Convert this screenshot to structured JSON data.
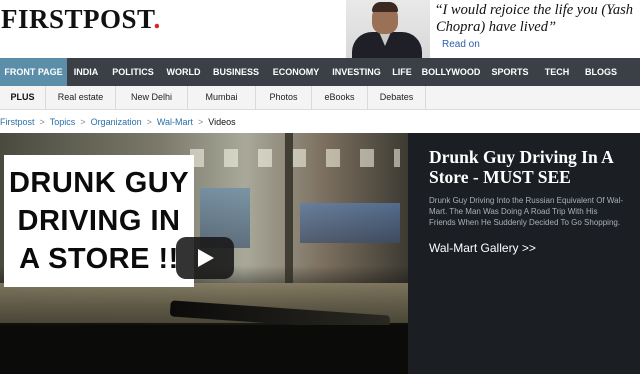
{
  "header": {
    "logo_text": "FIRSTPOST",
    "logo_dot": ".",
    "promo": {
      "quote_open": "“",
      "quote": "I would rejoice the life you (Yash Chopra) have lived”",
      "read_on": "Read on"
    }
  },
  "main_nav": {
    "items": [
      {
        "label": "FRONT PAGE",
        "active": true
      },
      {
        "label": "INDIA"
      },
      {
        "label": "POLITICS"
      },
      {
        "label": "WORLD"
      },
      {
        "label": "BUSINESS"
      },
      {
        "label": "ECONOMY"
      },
      {
        "label": "INVESTING"
      },
      {
        "label": "LIFE"
      },
      {
        "label": "BOLLYWOOD"
      },
      {
        "label": "SPORTS"
      },
      {
        "label": "TECH"
      },
      {
        "label": "BLOGS"
      }
    ]
  },
  "sub_nav": {
    "items": [
      "PLUS",
      "Real estate",
      "New Delhi",
      "Mumbai",
      "Photos",
      "eBooks",
      "Debates"
    ]
  },
  "breadcrumb": {
    "items": [
      "Firstpost",
      "Topics",
      "Organization",
      "Wal-Mart"
    ],
    "current": "Videos",
    "separator": ">"
  },
  "video": {
    "caption_lines": [
      "DRUNK GUY",
      "DRIVING IN",
      "A STORE !!"
    ],
    "play_icon": "play-icon"
  },
  "side_panel": {
    "title": "Drunk Guy Driving In A Store - MUST SEE",
    "description": "Drunk Guy Driving Into the Russian Equivalent Of Wal-Mart. The Man Was Doing A Road Trip With His Friends When He Suddenly Decided To Go Shopping.",
    "gallery_link": "Wal-Mart Gallery >>"
  },
  "colors": {
    "nav_bg": "#3b4046",
    "nav_active": "#5b8ea9",
    "logo_dot": "#d8262d",
    "link": "#2a6fa8",
    "side_bg": "#1b1f24"
  }
}
